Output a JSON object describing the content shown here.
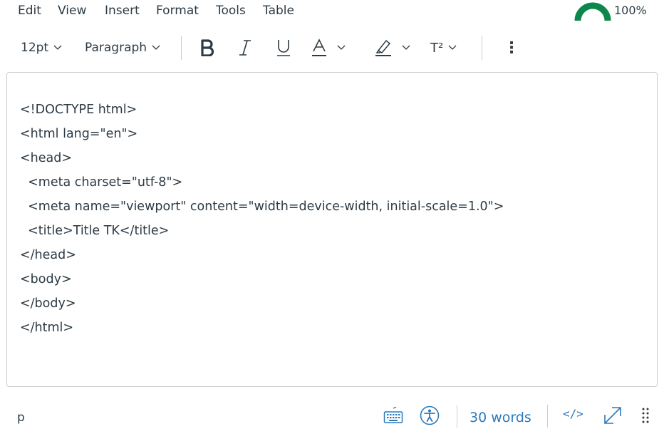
{
  "menu": {
    "items": [
      "Edit",
      "View",
      "Insert",
      "Format",
      "Tools",
      "Table"
    ]
  },
  "accessibility_checker": {
    "percent": "100%",
    "level": 1.0,
    "color": "#0b874b"
  },
  "toolbar": {
    "font_size": "12pt",
    "block_format": "Paragraph",
    "superscript_label": "T²",
    "more_label": "⋮"
  },
  "editor": {
    "lines": [
      "<!DOCTYPE html>",
      "<html lang=\"en\">",
      "<head>",
      "  <meta charset=\"utf-8\">",
      "  <meta name=\"viewport\" content=\"width=device-width, initial-scale=1.0\">",
      "  <title>Title TK</title>",
      "</head>",
      "<body>",
      "</body>",
      "</html>"
    ]
  },
  "statusbar": {
    "path": "p",
    "word_count": "30 words",
    "html_toggle": "</>"
  },
  "colors": {
    "text": "#2d3b45",
    "border": "#c7cdd1",
    "link": "#2b7abc",
    "accent_green": "#0b874b"
  },
  "icons": {
    "keyboard": "keyboard-icon",
    "accessibility": "accessibility-icon",
    "fullscreen": "fullscreen-icon",
    "resize": "resize-handle-icon"
  }
}
